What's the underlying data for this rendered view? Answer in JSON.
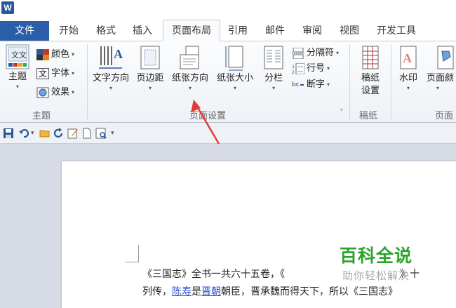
{
  "app": {
    "logo": "W"
  },
  "tabs": {
    "file": "文件",
    "items": [
      "开始",
      "格式",
      "插入",
      "页面布局",
      "引用",
      "邮件",
      "审阅",
      "视图",
      "开发工具"
    ],
    "active": "页面布局"
  },
  "ribbon": {
    "theme": {
      "label": "主题",
      "colors": "颜色",
      "fonts": "字体",
      "effects": "效果",
      "group": "主题"
    },
    "page_setup": {
      "text_direction": "文字方向",
      "margins": "页边距",
      "orientation": "纸张方向",
      "size": "纸张大小",
      "columns": "分栏",
      "breaks": "分隔符",
      "line_numbers": "行号",
      "hyphenation": "断字",
      "group": "页面设置",
      "launcher": "⌜"
    },
    "draft": {
      "label_line1": "稿纸",
      "label_line2": "设置",
      "group": "稿纸"
    },
    "background": {
      "watermark": "水印",
      "page_color": "页面颜",
      "group": "页面"
    },
    "caret": "▾"
  },
  "annotation": {
    "arrow_color": "#e53935"
  },
  "document": {
    "line1": {
      "text_a": "《三国志》全书一共六十五卷，《",
      "text_b": "》十"
    },
    "line2": {
      "text_a": "列传，",
      "link1": "陈寿",
      "text_b": "是",
      "link2": "晋朝",
      "text_c": "朝臣，晋承魏而得天下，所以《三国志》"
    }
  },
  "watermark": {
    "title": "百科全说",
    "subtitle": "助你轻松解决"
  }
}
